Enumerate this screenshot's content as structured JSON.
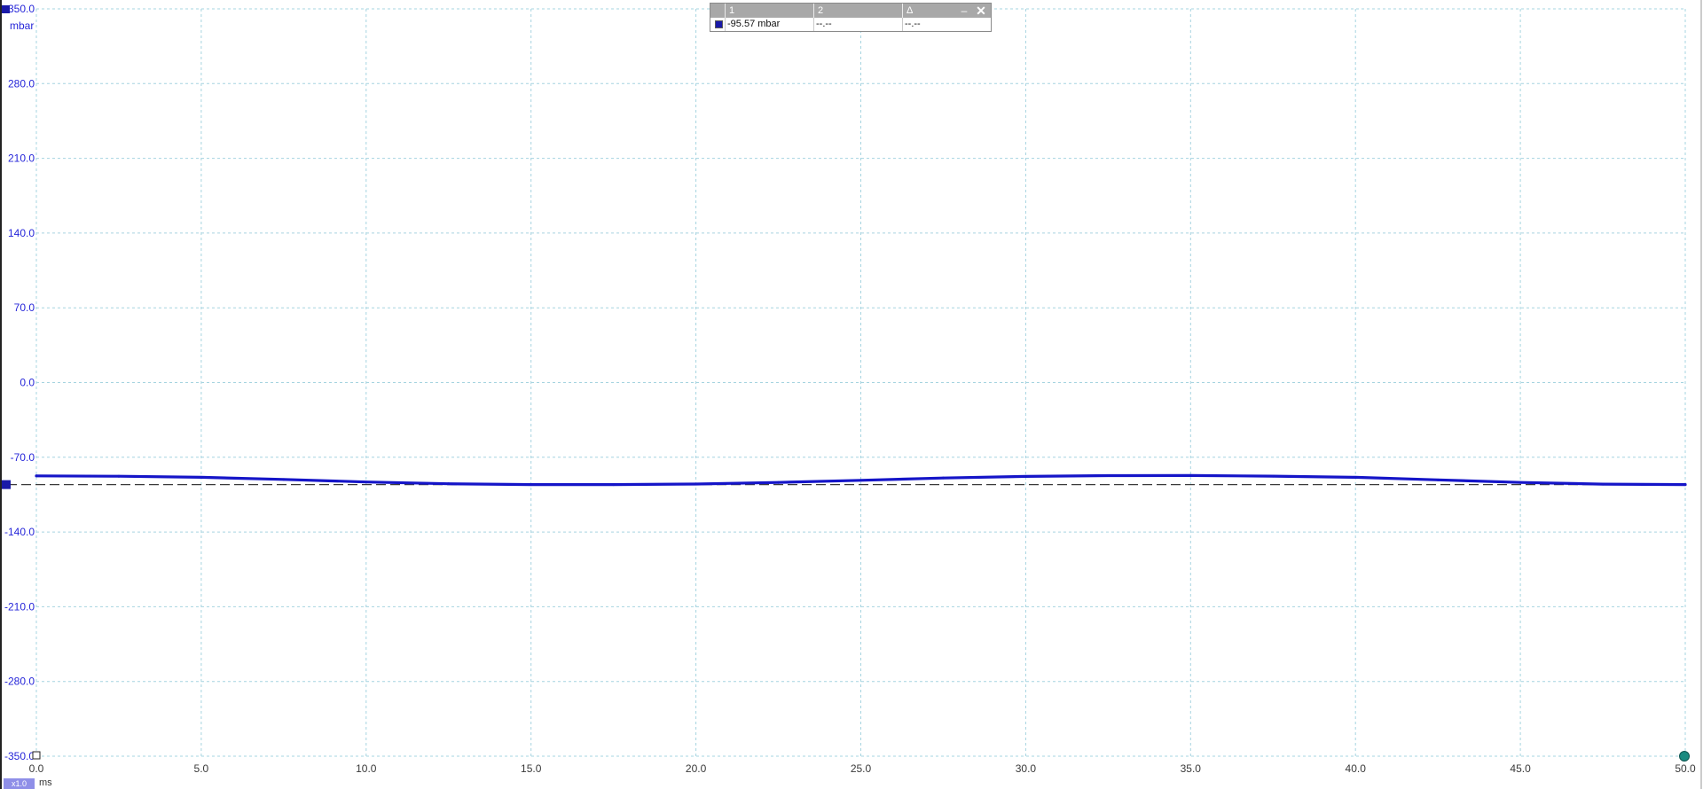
{
  "chart_data": {
    "type": "line",
    "title": "",
    "xlabel": "",
    "ylabel": "",
    "y_unit": "mbar",
    "x_unit": "ms",
    "xlim": [
      0,
      50
    ],
    "ylim": [
      -350,
      350
    ],
    "x_ticks": [
      "0.0",
      "5.0",
      "10.0",
      "15.0",
      "20.0",
      "25.0",
      "30.0",
      "35.0",
      "40.0",
      "45.0",
      "50.0"
    ],
    "y_ticks": [
      "350.0",
      "280.0",
      "210.0",
      "140.0",
      "70.0",
      "0.0",
      "-70.0",
      "-140.0",
      "-210.0",
      "-280.0",
      "-350.0"
    ],
    "grid": true,
    "reference_level": -95.6,
    "series": [
      {
        "color": "#1515c8",
        "x": [
          0,
          2.5,
          5,
          7.5,
          10,
          12.5,
          15,
          17.5,
          20,
          22.5,
          25,
          27.5,
          30,
          32.5,
          35,
          37.5,
          40,
          42.5,
          45,
          47.5,
          50
        ],
        "y": [
          -87.4,
          -87.8,
          -88.8,
          -90.8,
          -93.2,
          -94.8,
          -95.6,
          -95.6,
          -95.1,
          -93.6,
          -91.6,
          -89.4,
          -87.9,
          -87.2,
          -87.1,
          -87.7,
          -88.8,
          -91.2,
          -93.6,
          -95.2,
          -95.6
        ]
      }
    ]
  },
  "cursor_table": {
    "headers": [
      "1",
      "2",
      "Δ"
    ],
    "row": {
      "c1": "-95.57 mbar",
      "c2": "--.--",
      "c3": "--.--"
    }
  },
  "zoom_label": "x1.0",
  "colors": {
    "axis_text": "#2626d9",
    "trace": "#1515c8",
    "grid": "#a6d4e0",
    "cursor_header": "#a8a8a8"
  }
}
